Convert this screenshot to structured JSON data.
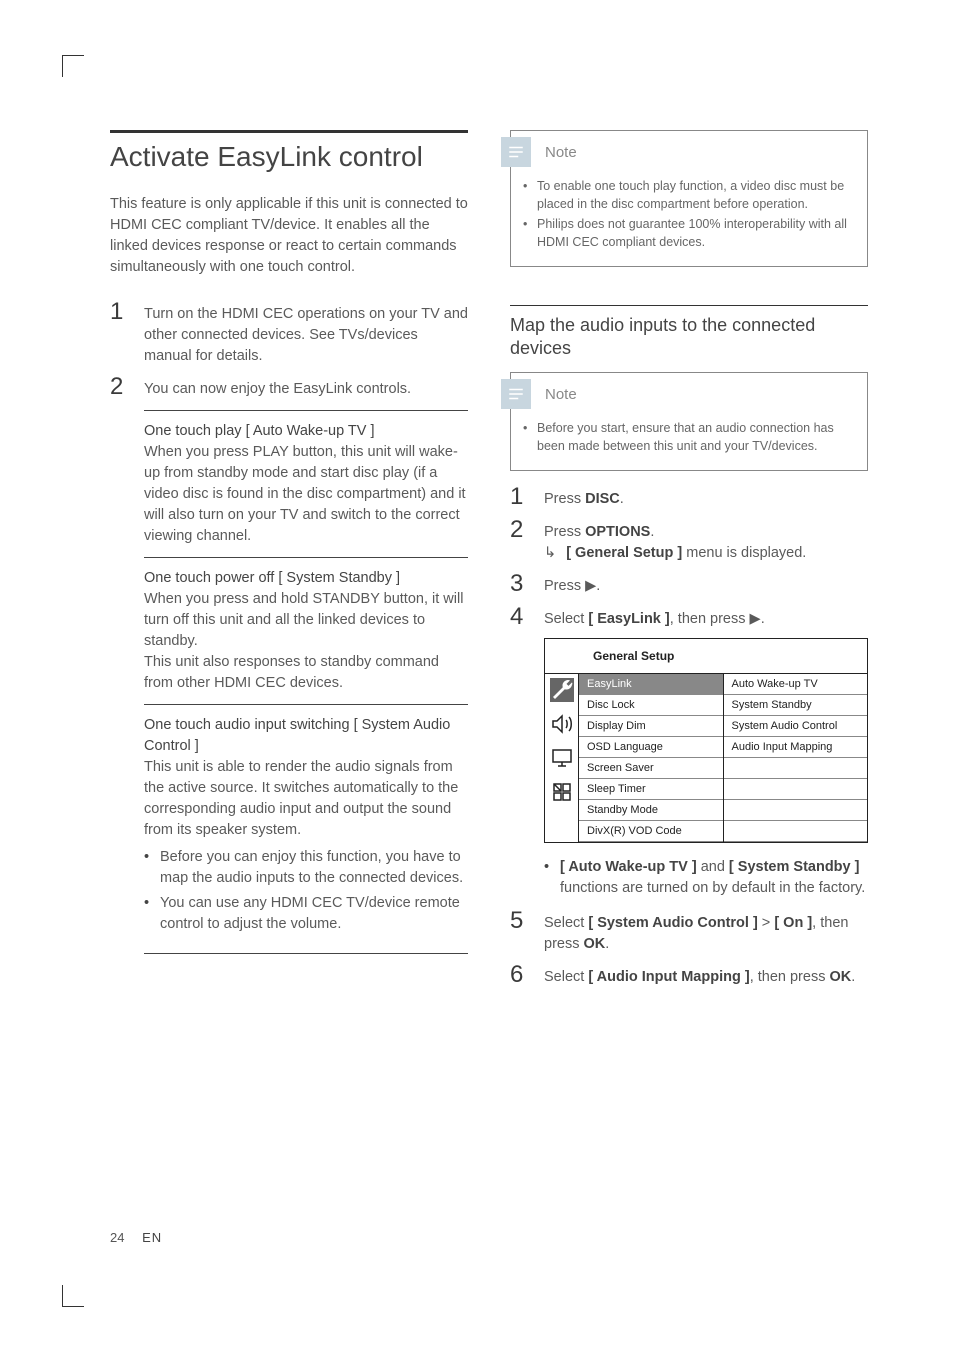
{
  "left": {
    "heading": "Activate EasyLink control",
    "intro": "This feature is only applicable if this unit is connected to HDMI CEC compliant TV/device. It enables all the linked devices response or react to certain commands simultaneously with one touch control.",
    "step1": "Turn on the HDMI CEC operations on your TV and other connected devices. See TVs/devices manual for details.",
    "step2": "You can now enjoy the EasyLink controls.",
    "feat1_title": "One touch play [ Auto Wake-up TV ]",
    "feat1_body": "When you press PLAY button, this unit will wake- up from standby mode and start disc play (if a video disc is found in the disc compartment) and it will also turn on your TV and switch to the correct viewing channel.",
    "feat2_title": "One touch power off [ System Standby ]",
    "feat2_body1": "When you press and hold STANDBY button, it will turn off this unit and all the linked devices to standby.",
    "feat2_body2": "This unit also responses to standby command from other HDMI CEC devices.",
    "feat3_title": "One touch audio input switching [ System Audio Control ]",
    "feat3_body": "This unit is able to render the audio signals from the active source.  It switches automatically to the corresponding audio input and output the sound from its speaker system.",
    "feat3_b1": "Before you can enjoy this function, you have to map the audio inputs to the connected devices.",
    "feat3_b2": "You can use any HDMI CEC TV/device remote control to adjust the volume."
  },
  "right": {
    "note1_title": "Note",
    "note1_b1": "To enable one touch play function, a video disc must be placed in the disc compartment before operation.",
    "note1_b2": "Philips does not guarantee 100% interoperability with all HDMI CEC compliant devices.",
    "subheading": "Map the audio inputs to the connected devices",
    "note2_title": "Note",
    "note2_b1": "Before you start, ensure that an audio connection has been made between this unit and your TV/devices.",
    "s1_pre": "Press ",
    "s1_b": "DISC",
    "s1_post": ".",
    "s2_pre": "Press ",
    "s2_b": "OPTIONS",
    "s2_post": ".",
    "s2_res_b": "[ General Setup ]",
    "s2_res_post": " menu is displayed.",
    "s3_pre": "Press ",
    "s3_post": ".",
    "s4_pre": "Select ",
    "s4_b": "[ EasyLink ]",
    "s4_mid": ", then press ",
    "s4_post": ".",
    "menu_title": "General Setup",
    "menu_left": [
      "EasyLink",
      "Disc Lock",
      "Display Dim",
      "OSD Language",
      "Screen Saver",
      "Sleep Timer",
      "Standby Mode",
      "DivX(R) VOD Code"
    ],
    "menu_right": [
      "Auto Wake-up TV",
      "System Standby",
      "System Audio Control",
      "Audio Input Mapping"
    ],
    "after_b1_a": "[ Auto Wake-up TV ]",
    "after_b1_mid": " and ",
    "after_b1_b": "[ System Standby ]",
    "after_b1_post": " functions are turned on by default in the factory.",
    "s5_pre": "Select ",
    "s5_b1": "[ System Audio Control ]",
    "s5_mid": " > ",
    "s5_b2": "[ On ]",
    "s5_mid2": ", then press ",
    "s5_b3": "OK",
    "s5_post": ".",
    "s6_pre": "Select ",
    "s6_b1": "[ Audio Input Mapping ]",
    "s6_mid": ", then press ",
    "s6_b2": "OK",
    "s6_post": "."
  },
  "page": {
    "num": "24",
    "lang": "EN"
  }
}
